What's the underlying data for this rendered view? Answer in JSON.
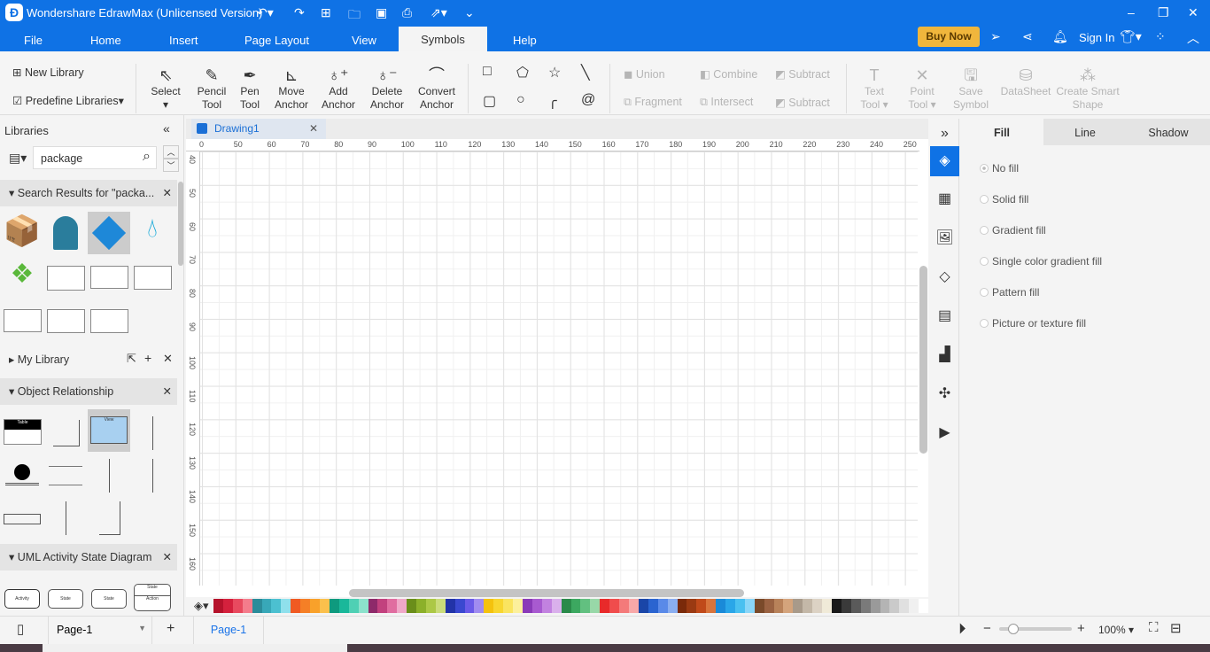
{
  "app": {
    "title": "Wondershare EdrawMax (Unlicensed Version)",
    "sign_in": "Sign In",
    "buy_now": "Buy Now"
  },
  "menu": [
    "File",
    "Home",
    "Insert",
    "Page Layout",
    "View",
    "Symbols",
    "Help"
  ],
  "ribbon": {
    "library": {
      "new": "New Library",
      "predefine": "Predefine Libraries"
    },
    "tools": [
      {
        "label": "Select",
        "icon": "pointer-icon"
      },
      {
        "label": "Pencil Tool",
        "icon": "pencil-icon"
      },
      {
        "label": "Pen Tool",
        "icon": "pen-icon"
      },
      {
        "label": "Move Anchor",
        "icon": "move-anchor-icon"
      },
      {
        "label": "Add Anchor",
        "icon": "add-anchor-icon"
      },
      {
        "label": "Delete Anchor",
        "icon": "delete-anchor-icon"
      },
      {
        "label": "Convert Anchor",
        "icon": "convert-anchor-icon"
      }
    ],
    "boolean": [
      "Union",
      "Combine",
      "Subtract",
      "Fragment",
      "Intersect",
      "Subtract"
    ],
    "more": [
      "Text Tool",
      "Point Tool",
      "Save Symbol",
      "DataSheet",
      "Create Smart Shape"
    ]
  },
  "left": {
    "title": "Libraries",
    "search_value": "package",
    "search_results": "Search Results for  \"packa...",
    "my_library": "My Library",
    "object_relationship": "Object Relationship",
    "uml": "UML Activity State Diagram",
    "thumb_text": {
      "table": "Table",
      "view": "View",
      "activity": "Activity",
      "state": "State",
      "action": "Action"
    }
  },
  "canvas": {
    "doc_tab": "Drawing1",
    "ruler_top": [
      "0",
      "50",
      "60",
      "70",
      "80",
      "90",
      "100",
      "110",
      "120",
      "130",
      "140",
      "150",
      "160",
      "170",
      "180",
      "190",
      "200",
      "210",
      "220",
      "230",
      "240",
      "250"
    ],
    "ruler_left": [
      "40",
      "50",
      "60",
      "70",
      "80",
      "90",
      "100",
      "110",
      "120",
      "130",
      "140",
      "150",
      "160"
    ]
  },
  "palette": [
    "#b5122b",
    "#d4213d",
    "#e84a5f",
    "#f47c8c",
    "#2b8c9a",
    "#38a8b8",
    "#4cc0d0",
    "#8fe0ec",
    "#f05a22",
    "#f57f26",
    "#f9a12a",
    "#fbc04c",
    "#0e9a7e",
    "#1ab89a",
    "#4fd0b4",
    "#8ce2cc",
    "#8e2a6a",
    "#c2417e",
    "#e06da0",
    "#f0a8c8",
    "#6a8e1a",
    "#8cb02a",
    "#acc846",
    "#cadc7a",
    "#2233a8",
    "#3a48d0",
    "#6a5ae8",
    "#a08cf0",
    "#f4c20d",
    "#f8d630",
    "#fae460",
    "#fcf09c",
    "#8a3ab8",
    "#a85ad0",
    "#c282e0",
    "#dab0ec",
    "#2a8a4a",
    "#3ca860",
    "#62c080",
    "#98d8a8",
    "#e82a2a",
    "#f04c4c",
    "#f47a7a",
    "#f8a8a8",
    "#1a46a8",
    "#2a64d0",
    "#5a8ae8",
    "#8aaef0",
    "#7a2a0a",
    "#9a3a12",
    "#c04a1a",
    "#d8743c",
    "#1a8ad8",
    "#2aa6e8",
    "#4ac0f0",
    "#8ad6f8",
    "#7a4a2a",
    "#9a6242",
    "#b8825a",
    "#d4a47c",
    "#a89a8a",
    "#c4b8a8",
    "#dcd2c4",
    "#f0ead8",
    "#1a1a1a",
    "#3a3a3a",
    "#5a5a5a",
    "#7a7a7a",
    "#9a9a9a",
    "#b4b4b4",
    "#cacaca",
    "#e0e0e0",
    "#f0f0f0",
    "#ffffff"
  ],
  "right": {
    "tabs": [
      "Fill",
      "Line",
      "Shadow"
    ],
    "fill_options": [
      "No fill",
      "Solid fill",
      "Gradient fill",
      "Single color gradient fill",
      "Pattern fill",
      "Picture or texture fill"
    ]
  },
  "status": {
    "page_select": "Page-1",
    "page_tab": "Page-1",
    "zoom": "100%",
    "zoom_level": 0.2
  }
}
